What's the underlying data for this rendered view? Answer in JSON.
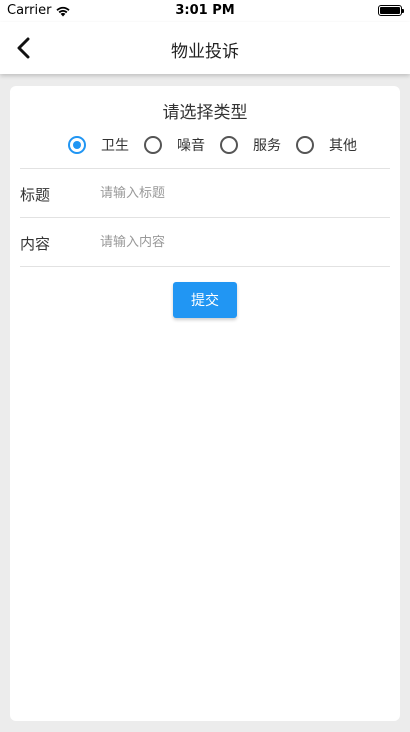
{
  "status_bar": {
    "carrier": "Carrier",
    "time": "3:01 PM"
  },
  "nav": {
    "title": "物业投诉",
    "back_icon": "chevron-left-icon"
  },
  "form": {
    "type_title": "请选择类型",
    "types": [
      {
        "label": "卫生",
        "checked": true
      },
      {
        "label": "噪音",
        "checked": false
      },
      {
        "label": "服务",
        "checked": false
      },
      {
        "label": "其他",
        "checked": false
      }
    ],
    "title_field": {
      "label": "标题",
      "placeholder": "请输入标题",
      "value": ""
    },
    "content_field": {
      "label": "内容",
      "placeholder": "请输入内容",
      "value": ""
    },
    "submit_label": "提交"
  },
  "colors": {
    "accent": "#2196f3",
    "background": "#ececec"
  }
}
